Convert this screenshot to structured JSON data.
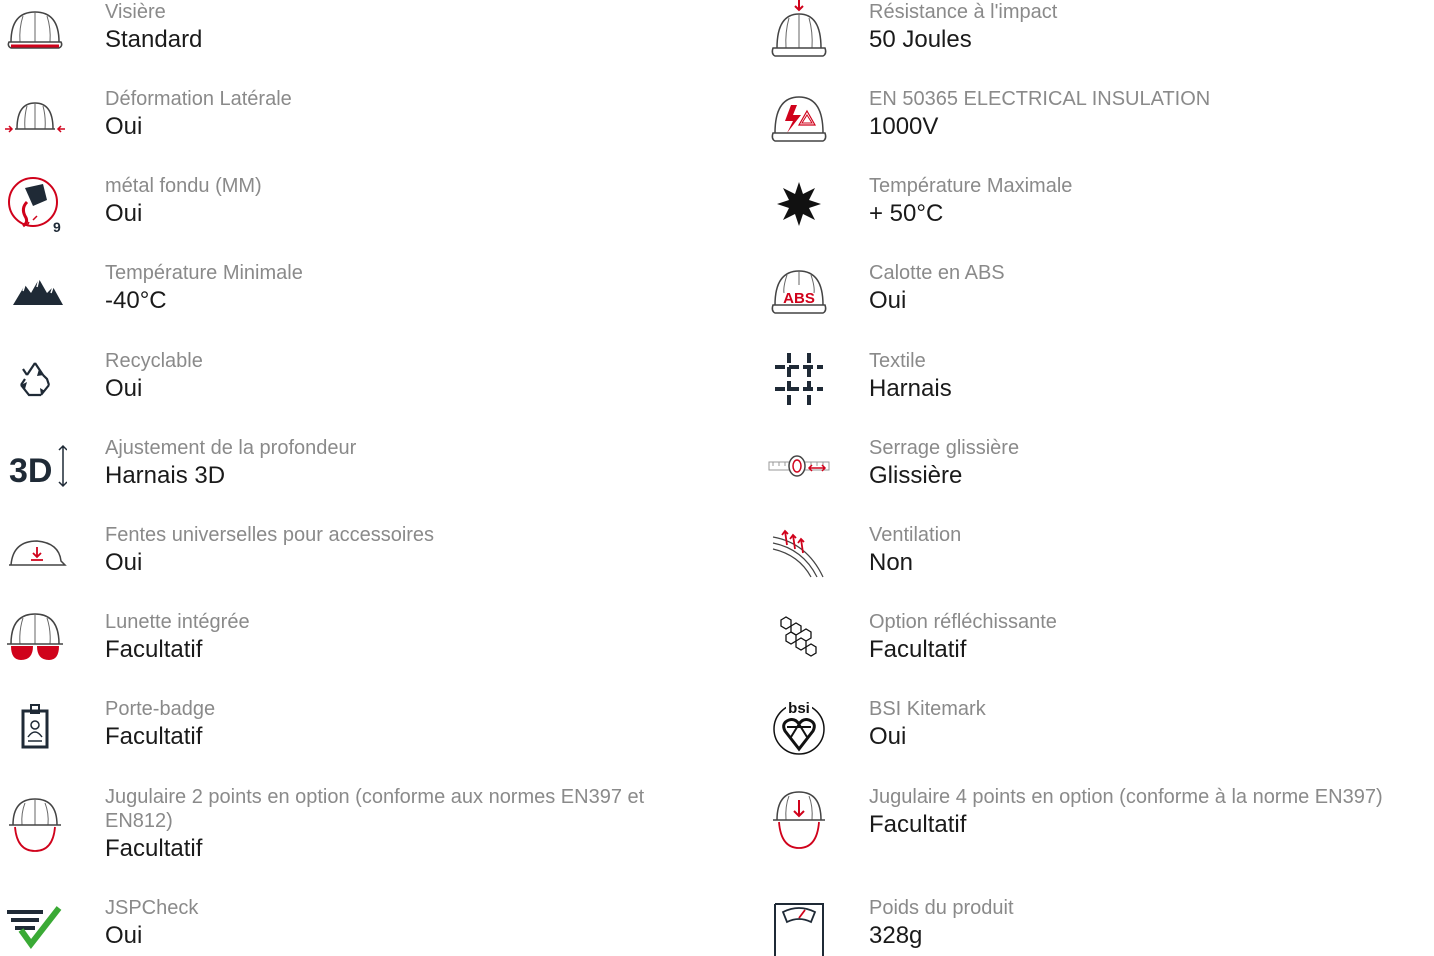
{
  "left": [
    {
      "icon": "helmet-visor-icon",
      "label": "Visière",
      "value": "Standard"
    },
    {
      "icon": "lateral-deformation-icon",
      "label": "Déformation Latérale",
      "value": "Oui"
    },
    {
      "icon": "molten-metal-icon",
      "label": "métal fondu (MM)",
      "value": "Oui"
    },
    {
      "icon": "mountains-icon",
      "label": "Température Minimale",
      "value": "-40°C"
    },
    {
      "icon": "recycle-icon",
      "label": "Recyclable",
      "value": "Oui"
    },
    {
      "icon": "3d-depth-icon",
      "label": "Ajustement de la profondeur",
      "value": "Harnais 3D"
    },
    {
      "icon": "accessory-slot-icon",
      "label": "Fentes universelles pour accessoires",
      "value": "Oui"
    },
    {
      "icon": "integrated-eyewear-icon",
      "label": "Lunette intégrée",
      "value": "Facultatif"
    },
    {
      "icon": "badge-holder-icon",
      "label": "Porte-badge",
      "value": "Facultatif"
    },
    {
      "icon": "chinstrap-2pt-icon",
      "label": "Jugulaire 2 points en option (conforme aux normes EN397 et EN812)",
      "value": "Facultatif"
    },
    {
      "icon": "jspcheck-icon",
      "label": "JSPCheck",
      "value": "Oui"
    }
  ],
  "right": [
    {
      "icon": "impact-resistance-icon",
      "label": "Résistance à l'impact",
      "value": "50 Joules"
    },
    {
      "icon": "electrical-insulation-icon",
      "label": "EN 50365 ELECTRICAL INSULATION",
      "value": "1000V"
    },
    {
      "icon": "sun-icon",
      "label": "Température Maximale",
      "value": "+ 50°C"
    },
    {
      "icon": "abs-shell-icon",
      "label": "Calotte en ABS",
      "value": "Oui"
    },
    {
      "icon": "textile-icon",
      "label": "Textile",
      "value": "Harnais"
    },
    {
      "icon": "slide-adjust-icon",
      "label": "Serrage glissière",
      "value": "Glissière"
    },
    {
      "icon": "ventilation-icon",
      "label": "Ventilation",
      "value": "Non"
    },
    {
      "icon": "reflective-icon",
      "label": "Option réfléchissante",
      "value": "Facultatif"
    },
    {
      "icon": "bsi-kitemark-icon",
      "label": "BSI Kitemark",
      "value": "Oui",
      "icon_text": "bsi"
    },
    {
      "icon": "chinstrap-4pt-icon",
      "label": "Jugulaire 4 points en option (conforme à la norme EN397)",
      "value": "Facultatif"
    },
    {
      "icon": "weight-scale-icon",
      "label": "Poids du produit",
      "value": "328g"
    }
  ],
  "icon_text": {
    "abs": "ABS",
    "molten_number": "9",
    "three_d": "3D"
  },
  "colors": {
    "label": "#8a8a8a",
    "value": "#1a1a1a",
    "accent": "#d0021b",
    "icon": "#1f2a36",
    "check": "#3aaa35"
  }
}
